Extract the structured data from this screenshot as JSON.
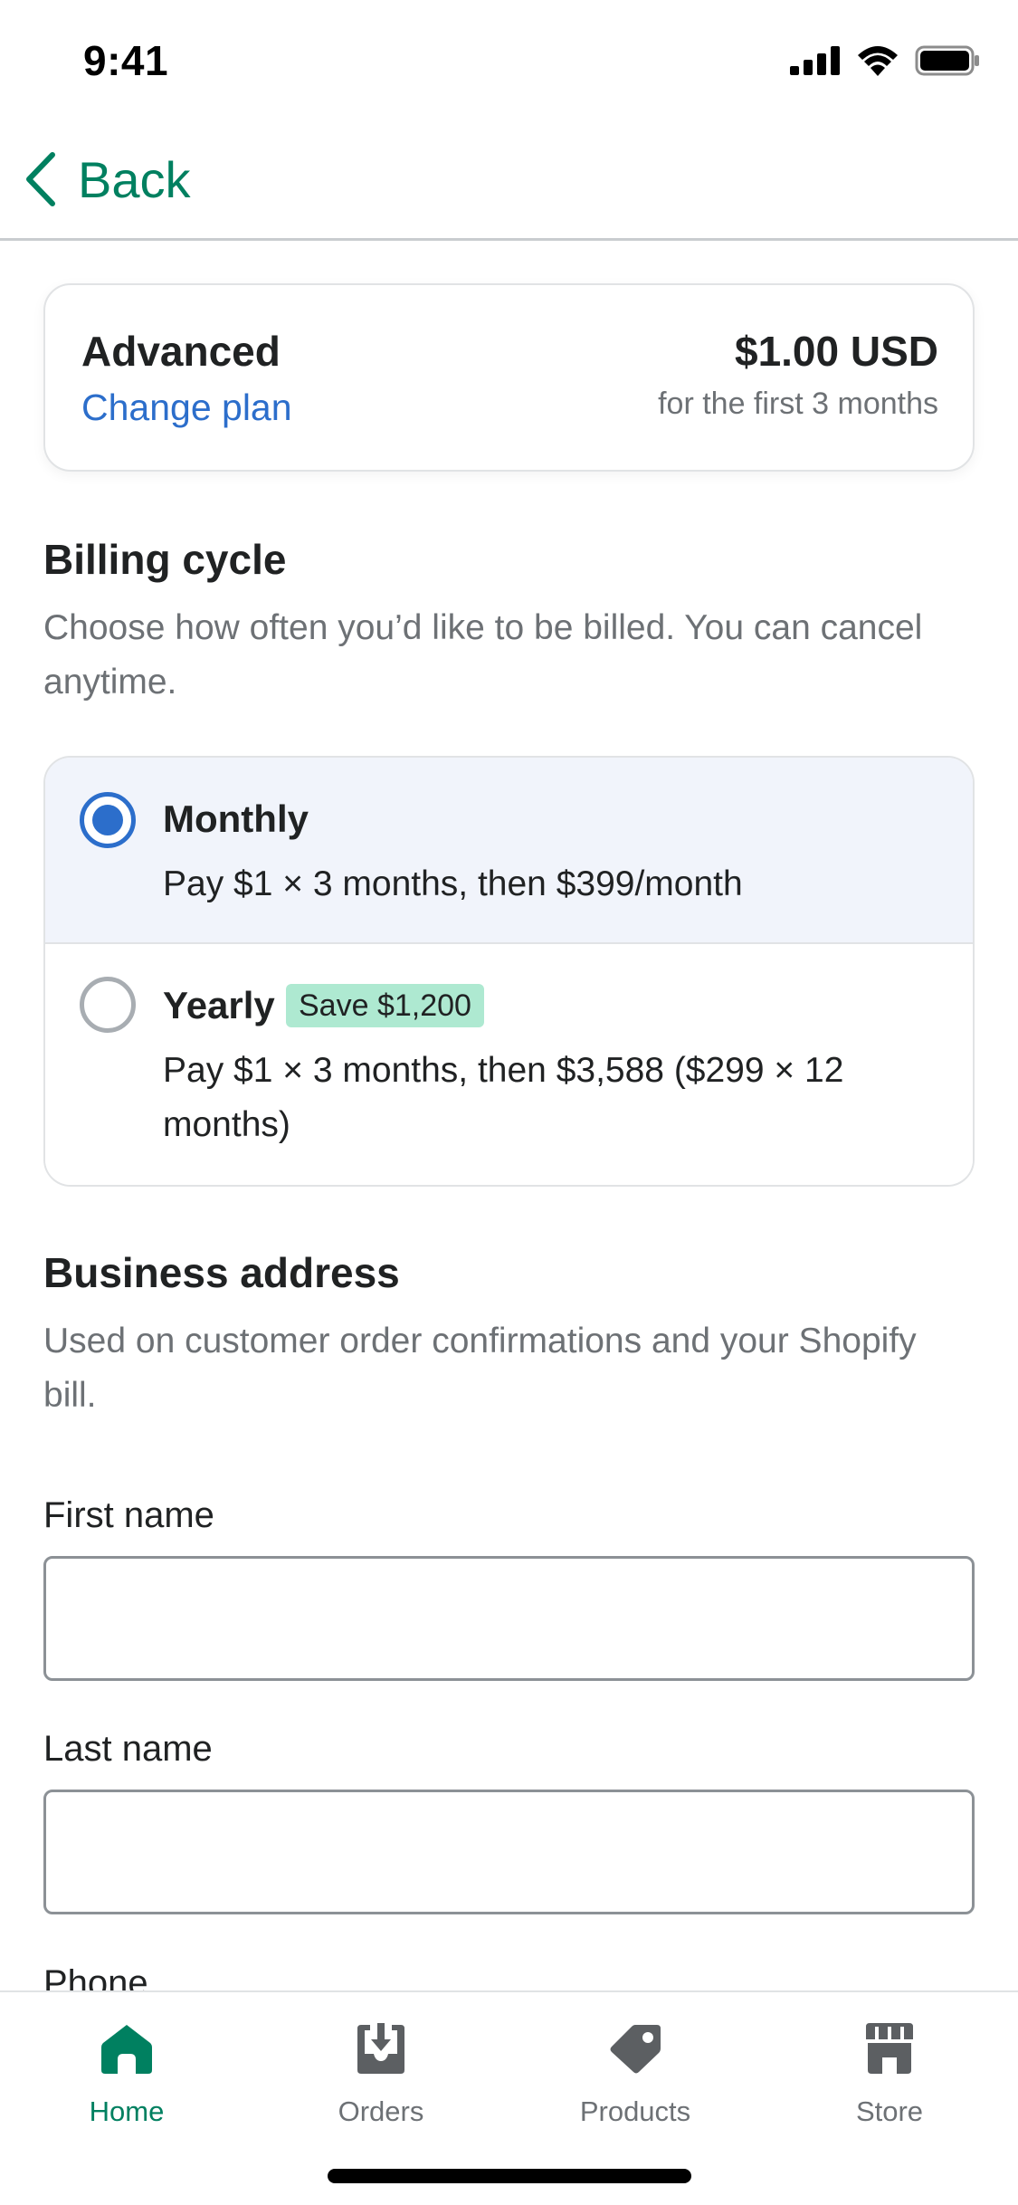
{
  "status_bar": {
    "time": "9:41"
  },
  "nav": {
    "back_label": "Back"
  },
  "plan": {
    "name": "Advanced",
    "change_label": "Change plan",
    "price": "$1.00 USD",
    "price_note": "for the first 3 months"
  },
  "billing": {
    "title": "Billing cycle",
    "description": "Choose how often you’d like to be billed. You can cancel anytime.",
    "options": [
      {
        "title": "Monthly",
        "description": "Pay $1 × 3 months, then $399/month",
        "selected": true
      },
      {
        "title": "Yearly",
        "badge": "Save $1,200",
        "description": "Pay $1 × 3 months, then $3,588 ($299 × 12 months)",
        "selected": false
      }
    ]
  },
  "address": {
    "title": "Business address",
    "description": "Used on customer order confirmations and your Shopify bill.",
    "fields": [
      {
        "label": "First name",
        "value": ""
      },
      {
        "label": "Last name",
        "value": ""
      },
      {
        "label": "Phone"
      }
    ]
  },
  "tabs": [
    {
      "label": "Home",
      "icon": "home-icon",
      "active": true
    },
    {
      "label": "Orders",
      "icon": "orders-icon",
      "active": false
    },
    {
      "label": "Products",
      "icon": "products-tag-icon",
      "active": false
    },
    {
      "label": "Store",
      "icon": "store-icon",
      "active": false
    }
  ],
  "colors": {
    "accent_green": "#008060",
    "link_blue": "#2c6ecb",
    "selected_bg": "#f1f4fb",
    "badge_green": "#aee9d1",
    "muted_text": "#6d7175"
  }
}
